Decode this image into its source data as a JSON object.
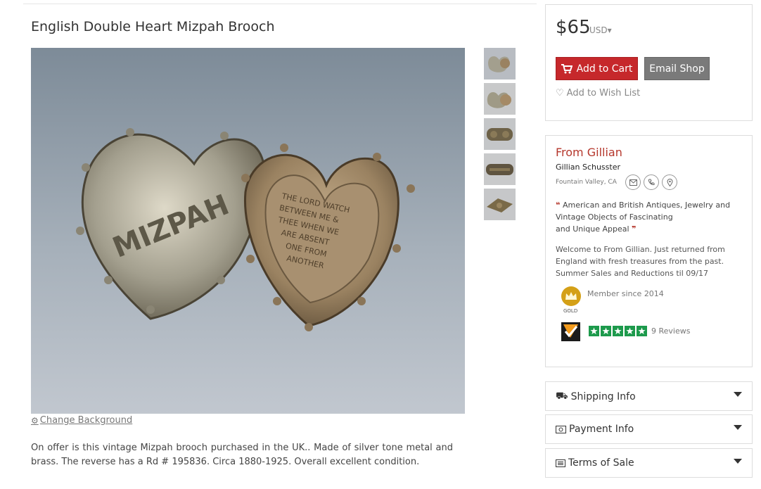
{
  "listing": {
    "title": "English Double Heart Mizpah Brooch",
    "change_background_label": "Change Background",
    "description": "On offer is this vintage Mizpah brooch purchased in the UK.. Made of silver tone metal and brass. The reverse has a Rd # 195836. Circa 1880-1925. Overall excellent condition.",
    "thumbnails": [
      "thumb-1",
      "thumb-2",
      "thumb-3",
      "thumb-4",
      "thumb-5"
    ]
  },
  "image_text": {
    "left_heart": "MIZPAH",
    "right_heart_lines": [
      "THE LORD WATCH",
      "BETWEEN ME &",
      "THEE WHEN WE",
      "ARE ABSENT",
      "ONE FROM",
      "ANOTHER"
    ]
  },
  "purchase": {
    "price": "$65",
    "currency": "USD",
    "add_to_cart": "Add to Cart",
    "email_shop": "Email Shop",
    "wish_list": "Add to Wish List"
  },
  "shop": {
    "name": "From Gillian",
    "owner": "Gillian Schusster",
    "location": "Fountain Valley, CA",
    "tagline_line1": "American and British Antiques, Jewelry and",
    "tagline_line2": "Vintage Objects of Fascinating",
    "tagline_line3": "and Unique Appeal",
    "welcome": "Welcome to From Gillian. Just returned from England with fresh treasures from the past. Summer Sales and Reductions til 09/17",
    "badge_label": "GOLD",
    "member_since": "Member since 2014",
    "rating_stars": 5,
    "reviews": "9 Reviews"
  },
  "accordions": {
    "shipping": "Shipping Info",
    "payment": "Payment Info",
    "terms": "Terms of Sale"
  },
  "colors": {
    "accent_red": "#c6282b",
    "shop_name": "#b5372c",
    "star_green": "#1d9a4c",
    "badge_gold": "#d4a017"
  }
}
